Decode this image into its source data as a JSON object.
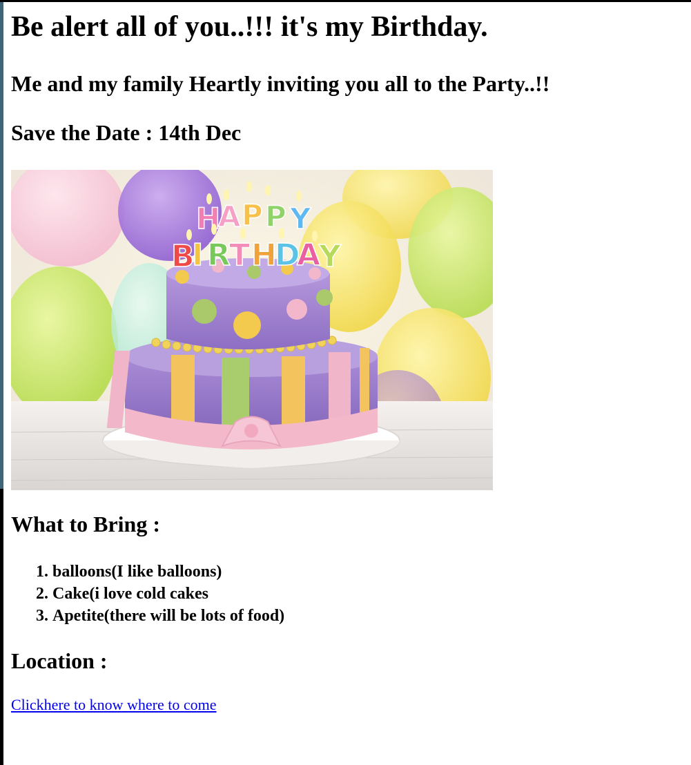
{
  "page": {
    "heading": "Be alert all of you..!!! it's my Birthday.",
    "invitation": "Me and my family Heartly inviting you all to the Party..!!",
    "save_the_date": "Save the Date : 14th Dec"
  },
  "photo": {
    "candle_letters_line1": [
      "H",
      "A",
      "P",
      "P",
      "Y"
    ],
    "candle_letters_line2": [
      "B",
      "I",
      "R",
      "T",
      "H",
      "D",
      "A",
      "Y"
    ]
  },
  "bring": {
    "title": "What to Bring :",
    "items": [
      "balloons(I like balloons)",
      "Cake(i love cold cakes",
      "Apetite(there will be lots of food)"
    ]
  },
  "location": {
    "title": "Location :",
    "link_text": "Clickhere to know where to come"
  },
  "colors": {
    "link": "#0000ee",
    "frame_tint": "#3f6577"
  }
}
